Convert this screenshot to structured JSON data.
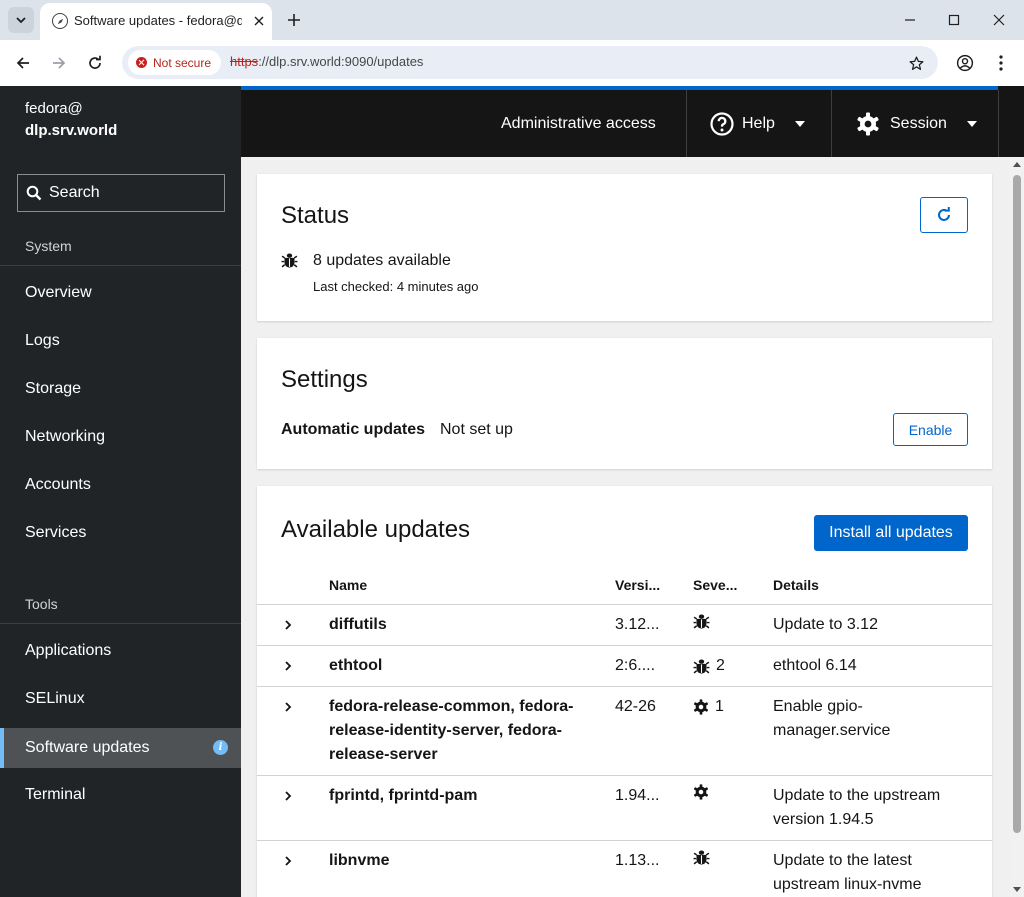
{
  "browser": {
    "tab_title": "Software updates - fedora@dlp",
    "security_label": "Not secure",
    "url_scheme": "https",
    "url_rest": "://dlp.srv.world:9090/updates"
  },
  "sidebar": {
    "host_user": "fedora@",
    "host_name": "dlp.srv.world",
    "search_label": "Search",
    "category_system": "System",
    "system_items": [
      "Overview",
      "Logs",
      "Storage",
      "Networking",
      "Accounts",
      "Services"
    ],
    "category_tools": "Tools",
    "tools_items": [
      "Applications",
      "SELinux",
      "Software updates",
      "Terminal"
    ],
    "active_item": "Software updates"
  },
  "masthead": {
    "admin_access": "Administrative access",
    "help": "Help",
    "session": "Session"
  },
  "status": {
    "title": "Status",
    "updates_available": "8 updates available",
    "last_checked": "Last checked: 4 minutes ago"
  },
  "settings": {
    "title": "Settings",
    "auto_label": "Automatic updates",
    "auto_value": "Not set up",
    "enable_button": "Enable"
  },
  "available": {
    "title": "Available updates",
    "install_button": "Install all updates",
    "columns": [
      "Name",
      "Versi...",
      "Seve...",
      "Details"
    ],
    "rows": [
      {
        "name": "diffutils",
        "version": "3.12...",
        "severity": "bug",
        "count": "",
        "details": "Update to 3.12"
      },
      {
        "name": "ethtool",
        "version": "2:6....",
        "severity": "bug",
        "count": "2",
        "details": "ethtool 6.14"
      },
      {
        "name": "fedora-release-common, fedora-release-identity-server, fedora-release-server",
        "version": "42-26",
        "severity": "enhancement",
        "count": "1",
        "details": "Enable gpio-manager.service"
      },
      {
        "name": "fprintd, fprintd-pam",
        "version": "1.94...",
        "severity": "enhancement",
        "count": "",
        "details": "Update to the upstream version 1.94.5"
      },
      {
        "name": "libnvme",
        "version": "1.13...",
        "severity": "bug",
        "count": "",
        "details": "Update to the latest upstream linux-nvme"
      }
    ]
  },
  "colors": {
    "accent": "#0066cc",
    "sidebar_bg": "#212427",
    "masthead_bg": "#151515",
    "active_border": "#73bcf7"
  }
}
